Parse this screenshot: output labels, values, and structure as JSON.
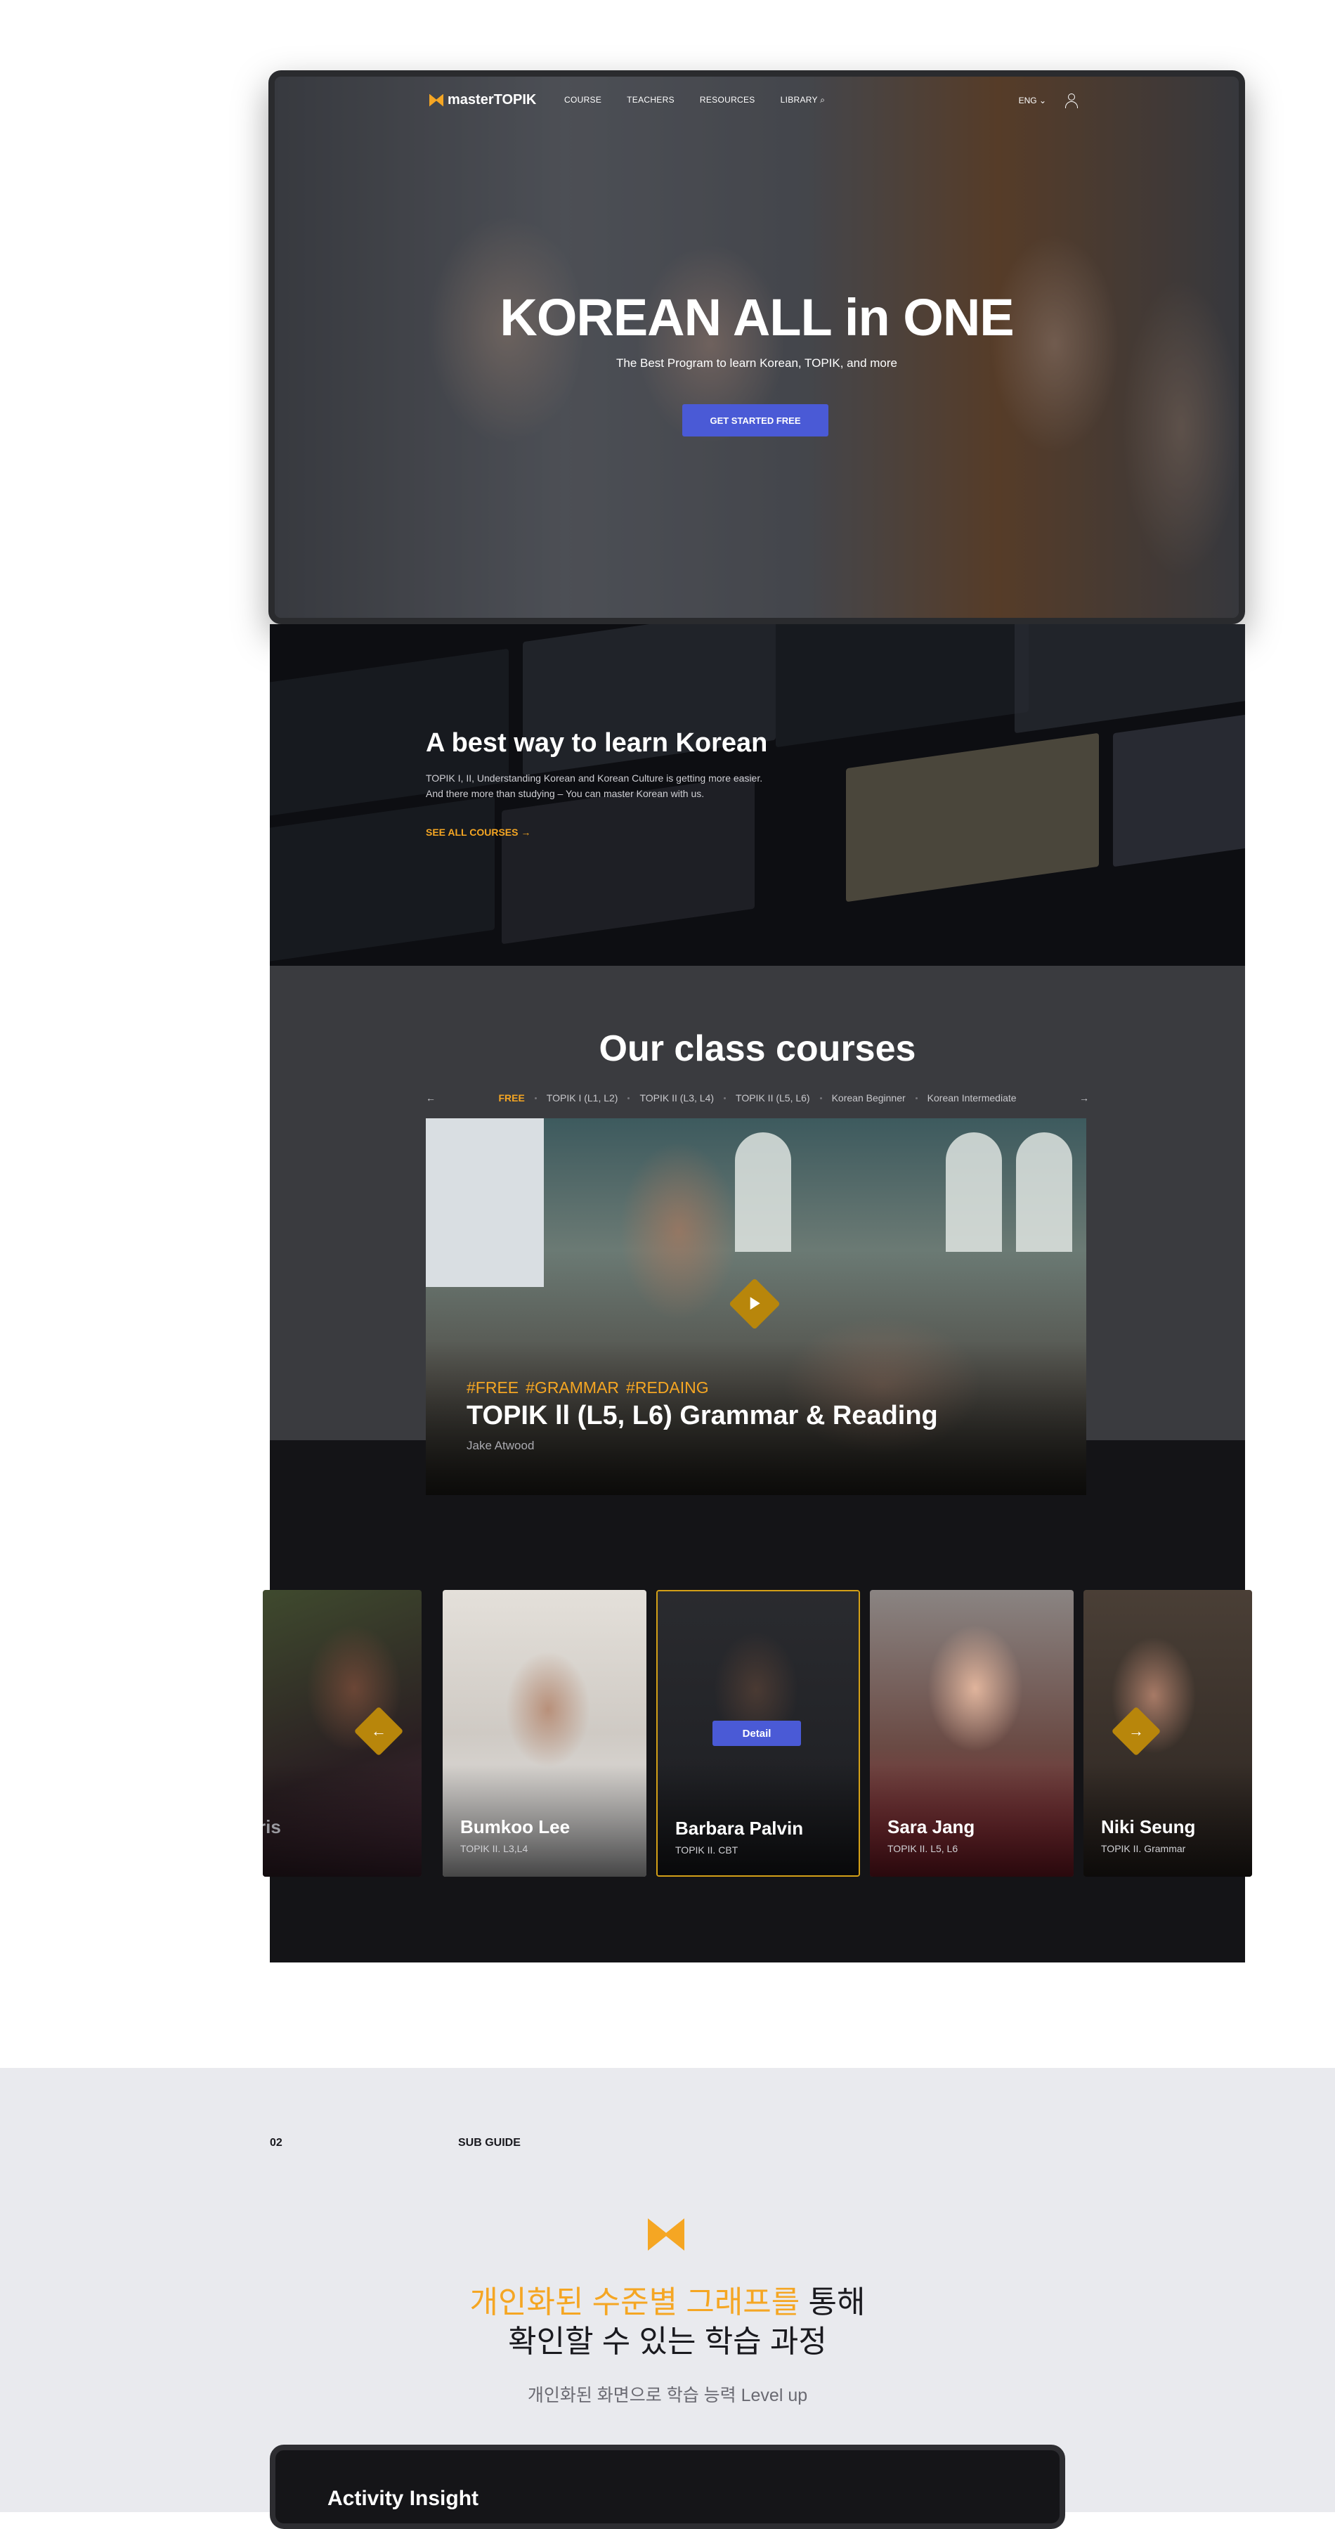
{
  "nav": {
    "logo": "masterTOPIK",
    "links": [
      "COURSE",
      "TEACHERS",
      "RESOURCES",
      "LIBRARY"
    ],
    "language": "ENG"
  },
  "hero": {
    "title": "KOREAN ALL in ONE",
    "subtitle": "The Best Program to learn Korean, TOPIK, and more",
    "cta": "GET STARTED FREE"
  },
  "best": {
    "title": "A best way to learn Korean",
    "desc_line1": "TOPIK I, II, Understanding Korean and Korean Culture is getting more easier.",
    "desc_line2": "And there more than studying – You can master Korean with us.",
    "link": "SEE ALL COURSES"
  },
  "courses": {
    "title": "Our class courses",
    "tabs": [
      "FREE",
      "TOPIK I (L1, L2)",
      "TOPIK II (L3, L4)",
      "TOPIK II (L5, L6)",
      "Korean Beginner",
      "Korean Intermediate"
    ],
    "feature": {
      "tags": [
        "#FREE",
        "#GRAMMAR",
        "#REDAING"
      ],
      "title": "TOPIK ll (L5, L6) Grammar & Reading",
      "author": "Jake Atwood"
    }
  },
  "teachers": [
    {
      "name": "ris",
      "level": ""
    },
    {
      "name": "Bumkoo Lee",
      "level": "TOPIK II. L3,L4"
    },
    {
      "name": "Barbara Palvin",
      "level": "TOPIK II. CBT",
      "button": "Detail"
    },
    {
      "name": "Sara Jang",
      "level": "TOPIK II. L5, L6"
    },
    {
      "name": "Niki Seung",
      "level": "TOPIK II. Grammar"
    }
  ],
  "guide": {
    "number": "02",
    "label": "SUB GUIDE",
    "title_highlight": "개인화된 수준별 그래프를",
    "title_rest1": " 통해",
    "title_line2": "확인할 수 있는 학습 과정",
    "subtitle": "개인화된 화면으로 학습 능력 Level up",
    "device_title": "Activity Insight"
  },
  "colors": {
    "accent": "#f5a623",
    "primary_button": "#4a5ad6",
    "dark_bg": "#141417"
  }
}
